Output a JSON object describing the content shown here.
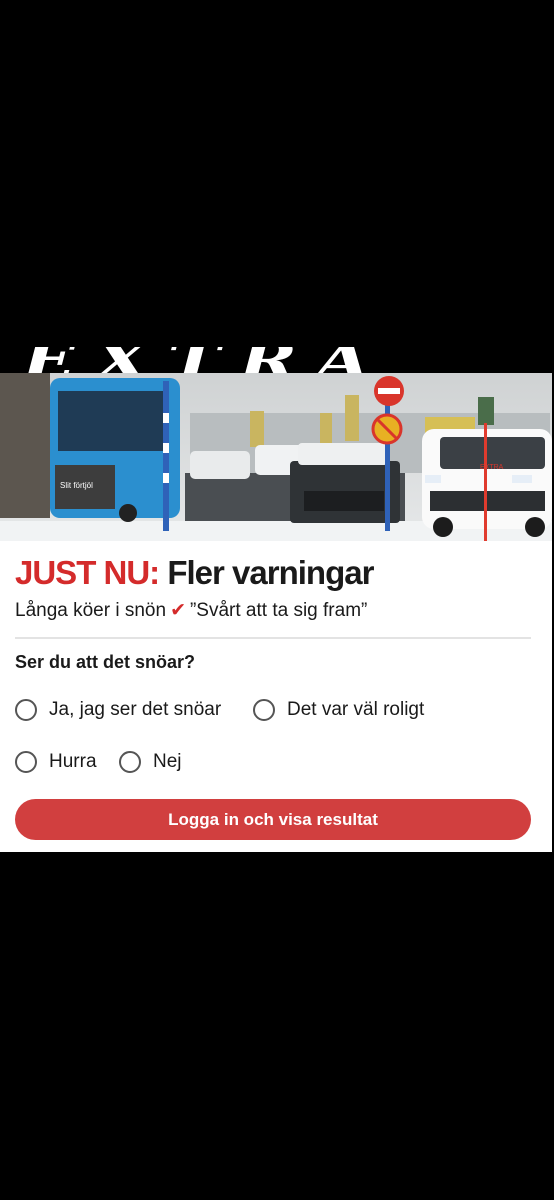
{
  "banner": {
    "text": "EXTRA"
  },
  "article": {
    "headline_prefix": "JUST NU:",
    "headline_main": "Fler varningar",
    "sub_left": "Långa köer i snön",
    "sub_right": "”Svårt att ta sig fram”",
    "check_icon": "checkmark-icon"
  },
  "poll": {
    "question": "Ser du att det snöar?",
    "options": [
      {
        "label": "Ja, jag ser det snöar"
      },
      {
        "label": "Det var väl roligt"
      },
      {
        "label": "Hurra"
      },
      {
        "label": "Nej"
      }
    ],
    "submit_label": "Logga in och visa resultat"
  },
  "photo_signage": {
    "bus_sign": "Slit förtjöl",
    "van_text": "EXTRA"
  },
  "colors": {
    "accent_red": "#d42b2b",
    "button_red": "#d13f3f",
    "bus_blue": "#2b8fcf"
  }
}
